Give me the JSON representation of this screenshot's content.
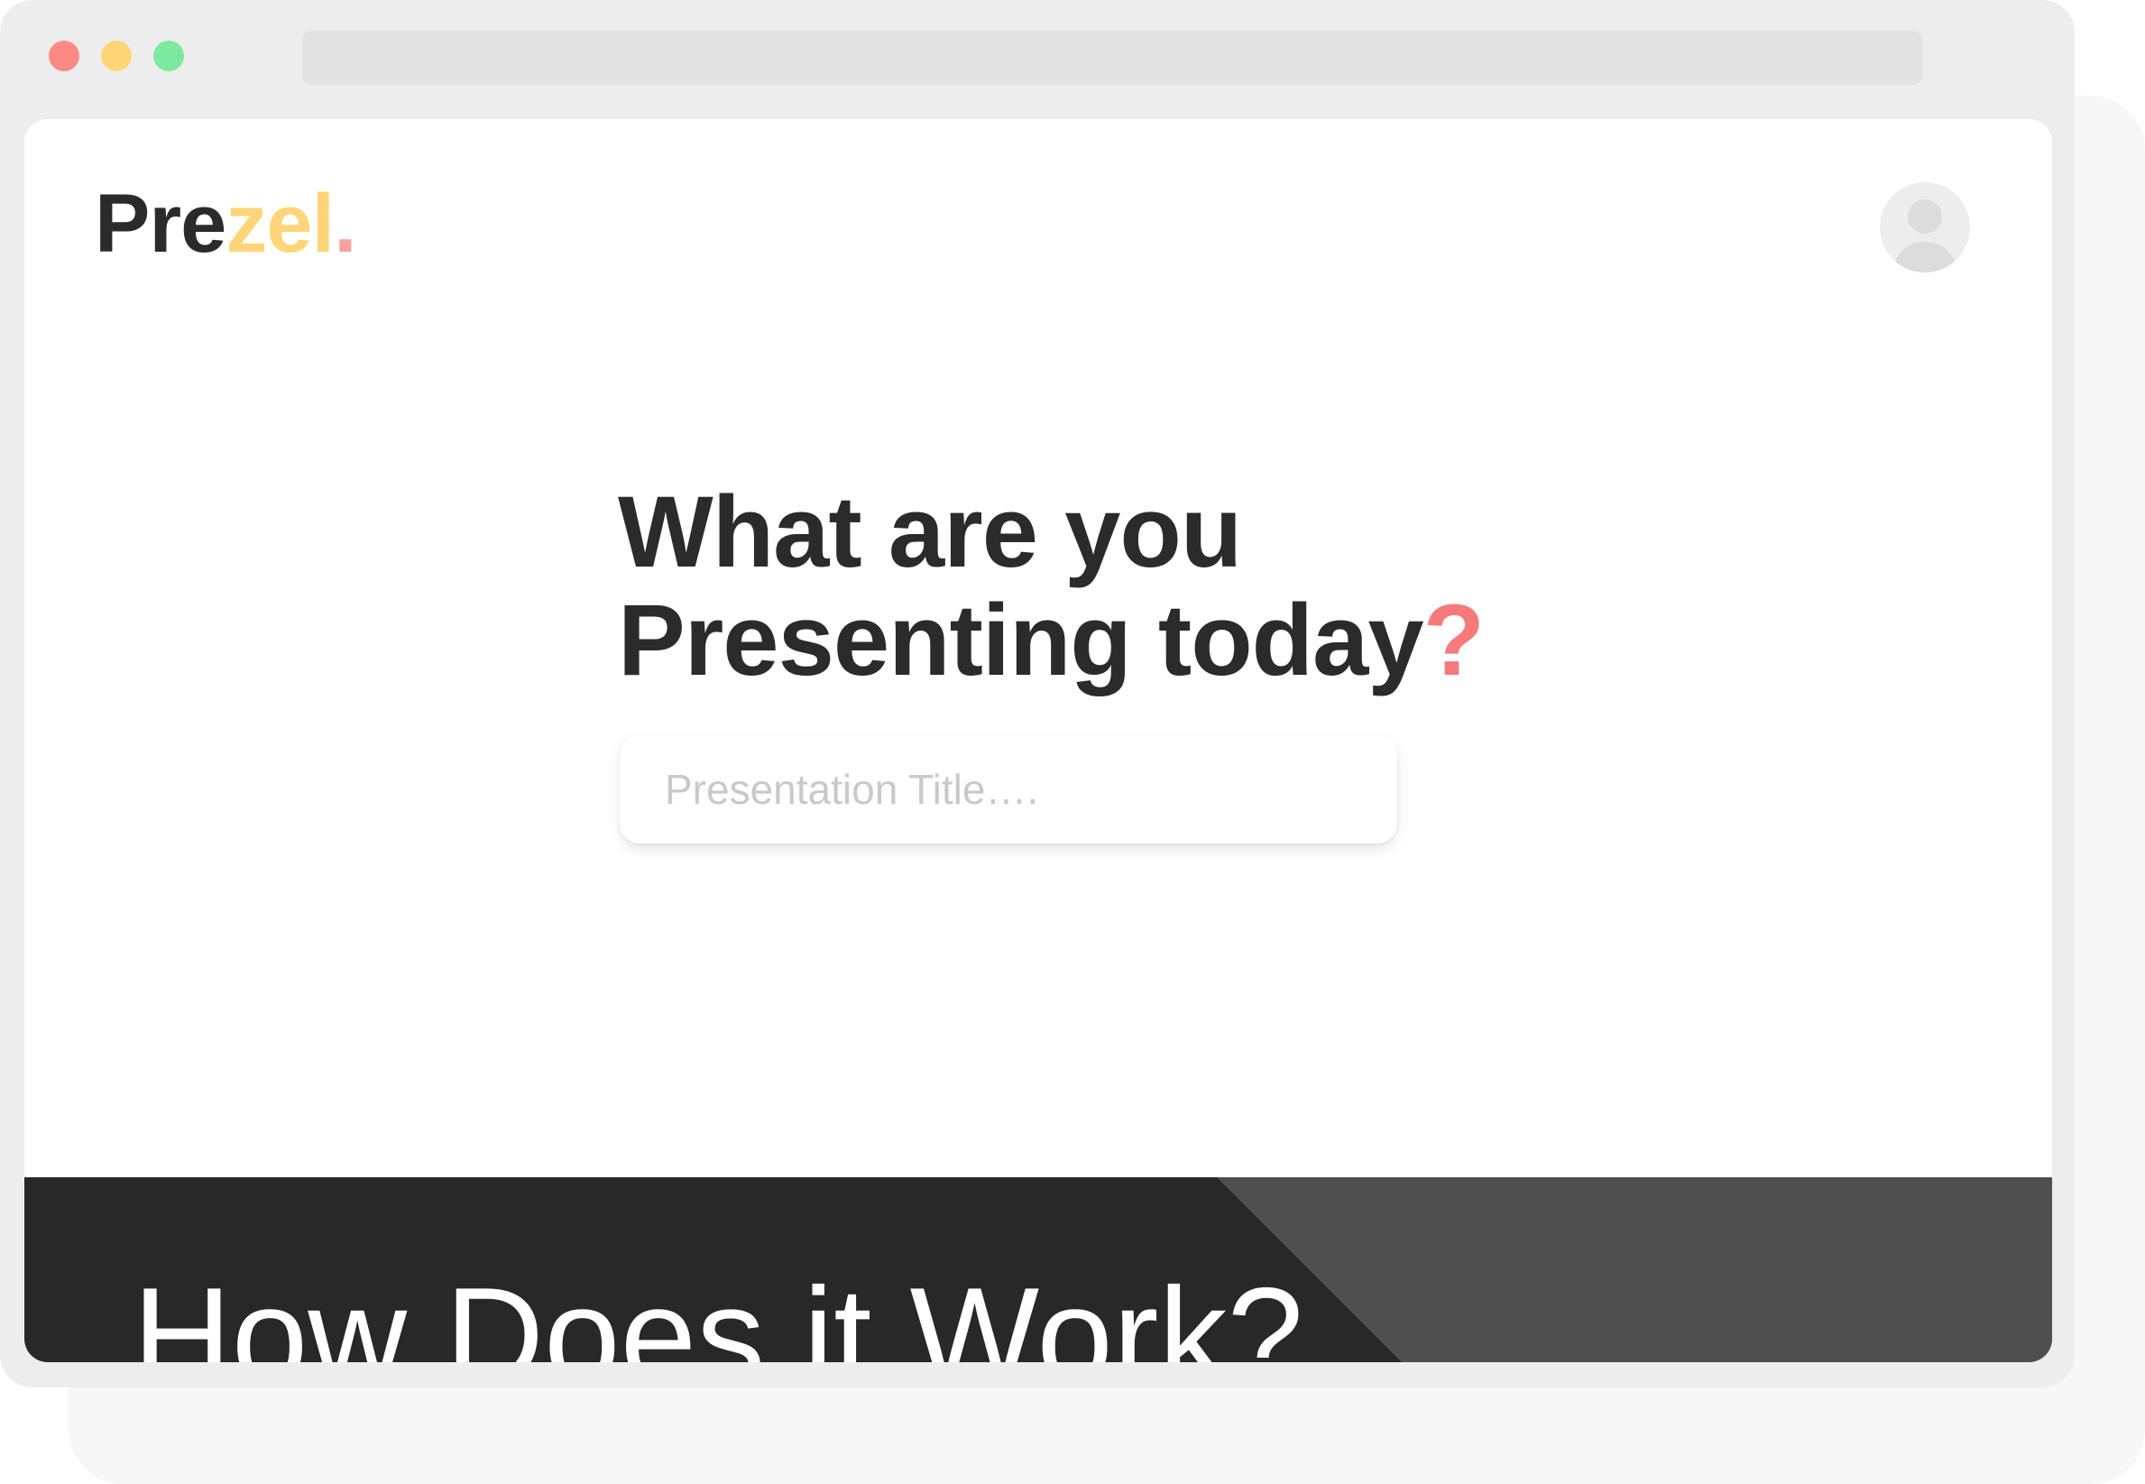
{
  "window": {
    "controls": [
      {
        "name": "close",
        "color": "#ff8a85"
      },
      {
        "name": "minimize",
        "color": "#ffd57a"
      },
      {
        "name": "maximize",
        "color": "#7de89f"
      }
    ]
  },
  "header": {
    "logo": {
      "part1": "Pre",
      "part2": "zel",
      "part3": ".",
      "colors": {
        "part1": "#2b2b2b",
        "part2": "#ffd57a",
        "part3": "#ff9e9e"
      }
    },
    "avatar_icon": "user-avatar-icon"
  },
  "hero": {
    "heading_line1": "What are you",
    "heading_line2": "Presenting today",
    "heading_mark": "?",
    "accent_color": "#f77a7a",
    "input": {
      "placeholder": "Presentation Title….",
      "value": ""
    }
  },
  "how_it_works": {
    "heading": "How Does it Work?",
    "colors": {
      "dark": "#282828",
      "light": "#4f4f4f"
    }
  }
}
